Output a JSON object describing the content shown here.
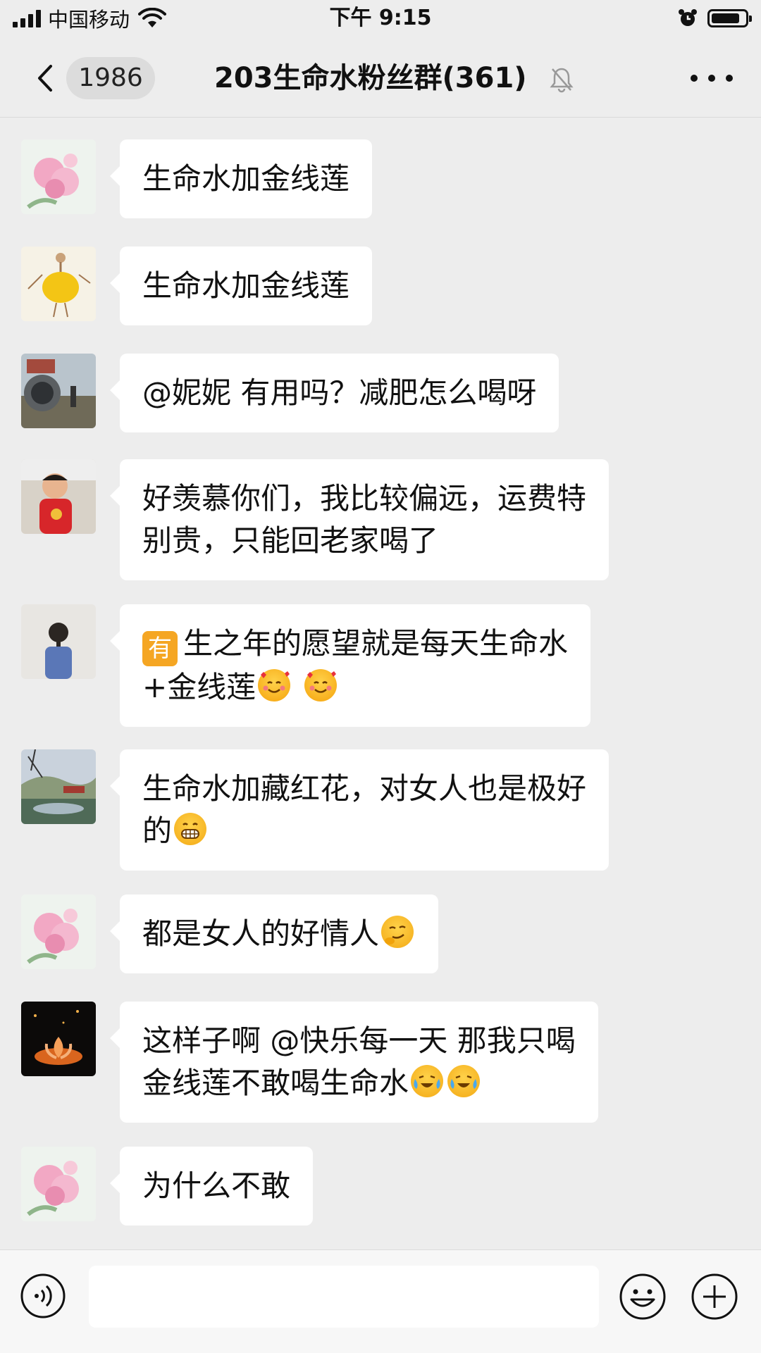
{
  "status_bar": {
    "carrier": "中国移动",
    "time": "下午 9:15",
    "battery_level": 0.85
  },
  "header": {
    "back_count": "1986",
    "title": "203生命水粉丝群(361)"
  },
  "messages": [
    {
      "avatar": "pink-flower-avatar",
      "text": "生命水加金线莲"
    },
    {
      "avatar": "yellow-dress-drawing-avatar",
      "text": "生命水加金线莲"
    },
    {
      "avatar": "pipe-landscape-avatar",
      "text": "@妮妮 有用吗？减肥怎么喝呀"
    },
    {
      "avatar": "child-photo-avatar",
      "line1": "好羡慕你们，我比较偏远，运费特",
      "line2": "别贵，只能回老家喝了"
    },
    {
      "avatar": "braid-girl-avatar",
      "badge": "有",
      "line1": "生之年的愿望就是每天生命水",
      "line2": "+金线莲",
      "emojis": [
        "smiling-face-with-hearts",
        "smiling-face-with-hearts"
      ]
    },
    {
      "avatar": "pond-park-avatar",
      "line1": "生命水加藏红花，对女人也是极好",
      "line2": "的",
      "emojis": [
        "grinning-face"
      ]
    },
    {
      "avatar": "pink-flower-avatar",
      "text": "都是女人的好情人",
      "emojis": [
        "smirking-thinking-face"
      ]
    },
    {
      "avatar": "lotus-lamp-avatar",
      "line1": "这样子啊 @快乐每一天 那我只喝",
      "line2": "金线莲不敢喝生命水",
      "emojis": [
        "crying-laughing-face",
        "crying-laughing-face"
      ]
    },
    {
      "avatar": "pink-flower-avatar",
      "text": "为什么不敢"
    }
  ],
  "input": {
    "placeholder": ""
  },
  "colors": {
    "background": "#ededed",
    "bubble": "#ffffff",
    "badge": "#f5a623"
  }
}
